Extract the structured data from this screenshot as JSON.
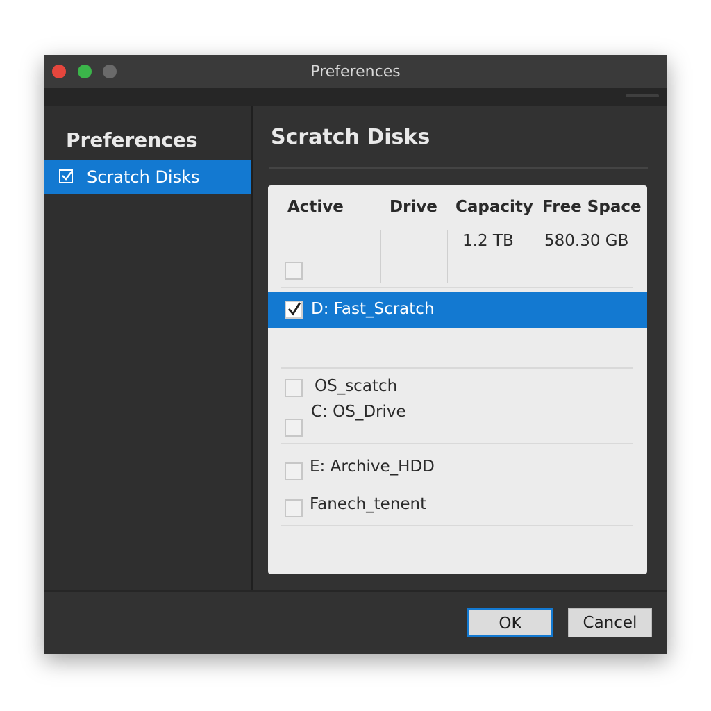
{
  "window": {
    "title": "Preferences"
  },
  "sidebar": {
    "heading": "Preferences",
    "items": [
      {
        "label": "Scratch Disks",
        "checked": true,
        "selected": true
      }
    ]
  },
  "main": {
    "title": "Scratch Disks",
    "table": {
      "columns": [
        "Active",
        "Drive",
        "Capacity",
        "Free Space"
      ],
      "first_row": {
        "active": false,
        "drive": "",
        "capacity": "1.2 TB",
        "free_space": "580.30 GB"
      },
      "rows": [
        {
          "label": "D: Fast_Scratch",
          "checked": true,
          "selected": true
        },
        {
          "label": "OS_scatch",
          "checked": false
        },
        {
          "label": "C: OS_Drive",
          "checked": false
        },
        {
          "label": "E: Archive_HDD",
          "checked": false
        },
        {
          "label": "Fanech_tenent",
          "checked": false
        }
      ]
    }
  },
  "buttons": {
    "ok": "OK",
    "cancel": "Cancel"
  },
  "colors": {
    "accent": "#1379d1",
    "window_bg": "#323232",
    "panel_bg": "#ececec"
  }
}
